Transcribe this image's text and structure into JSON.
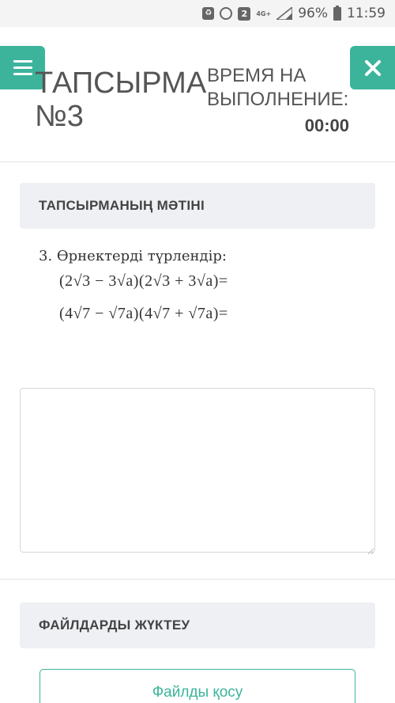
{
  "status_bar": {
    "notification_badge": "2",
    "network": "4G+",
    "battery": "96%",
    "time": "11:59"
  },
  "header": {
    "title": "ТАПСЫРМА №3",
    "time_label": "ВРЕМЯ НА ВЫПОЛНЕНИЕ:",
    "time_value": "00:00"
  },
  "task": {
    "section_title": "ТАПСЫРМАНЫҢ МӘТІНІ",
    "intro": "3. Өрнектерді түрлендір:",
    "expressions": [
      "(2√3 − 3√a)(2√3 + 3√a)=",
      "(4√7 − √7a)(4√7 + √7a)="
    ]
  },
  "answer": {
    "value": ""
  },
  "upload": {
    "section_title": "ФАЙЛДАРДЫ ЖҮКТЕУ",
    "add_button_label": "Файлды қосу"
  },
  "colors": {
    "accent": "#3cb49b",
    "section_header_bg": "#eef0f4"
  }
}
